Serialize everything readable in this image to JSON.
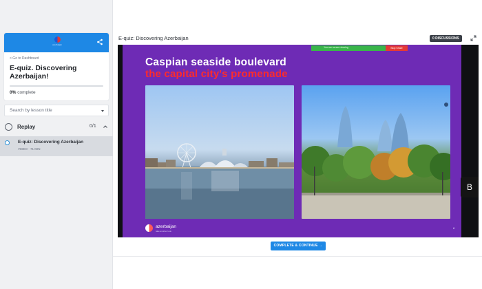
{
  "sidebar": {
    "back_link": "< Go to Dashboard",
    "course_title": "E-quiz. Discovering Azerbaijan!",
    "progress_percent": 0,
    "progress_value": "0%",
    "progress_suffix": "complete",
    "search_placeholder": "Search by lesson title",
    "section": {
      "label": "Replay",
      "count": "0/1"
    },
    "lesson": {
      "title": "E-quiz: Discovering Azerbaijan",
      "meta": "VIDEO · 71 MIN"
    }
  },
  "main": {
    "lesson_title": "E-quiz: Discovering Azerbaijan",
    "discussions_label": "0 DISCUSSIONS",
    "complete_button": "COMPLETE & CONTINUE →"
  },
  "slide": {
    "share_bar_text": "You are screen sharing",
    "stop_share": "Stop Share",
    "title": "Caspian seaside boulevard",
    "subtitle": "the capital city's promenade",
    "logo_name": "azerbaijan",
    "logo_tagline": "take another look",
    "page_number": "8",
    "side_tab_glyph": "B"
  },
  "colors": {
    "accent": "#1e88e5",
    "slide_bg": "#6e2bb5",
    "subtitle_red": "#ff2b2b"
  },
  "icons": [
    "share-icon",
    "chevron-up-icon",
    "dropdown-caret-icon",
    "expand-icon",
    "chat-icon"
  ]
}
